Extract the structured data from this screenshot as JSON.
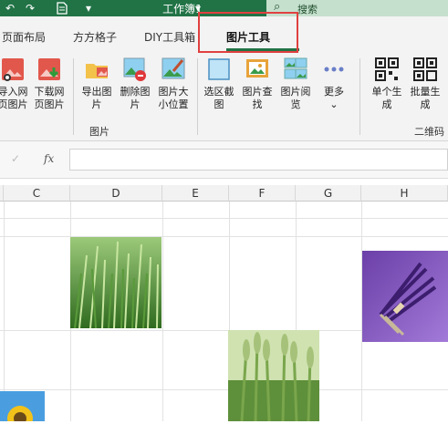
{
  "titlebar": {
    "title": "工作簿1",
    "search_label": "搜索",
    "icons": [
      "undo-icon",
      "redo-icon",
      "file-save-icon",
      "customize-dropdown-icon",
      "search-icon"
    ]
  },
  "tabs": [
    {
      "label": "页面布局"
    },
    {
      "label": "方方格子"
    },
    {
      "label": "DIY工具箱"
    },
    {
      "label": "图片工具",
      "active": true
    }
  ],
  "ribbon": {
    "buttons": [
      {
        "label": "导入网页图片"
      },
      {
        "label": "下载网页图片"
      },
      {
        "label": "导出图片"
      },
      {
        "label": "删除图片"
      },
      {
        "label": "图片大小位置"
      },
      {
        "label": "选区截图"
      },
      {
        "label": "图片查找"
      },
      {
        "label": "图片阅览"
      },
      {
        "label": "更多"
      },
      {
        "label": "单个生成"
      },
      {
        "label": "批量生成"
      }
    ],
    "groups": [
      {
        "label": "图片"
      },
      {
        "label": "二维码"
      }
    ]
  },
  "formula_bar": {
    "fx": "fx",
    "value": ""
  },
  "sheet": {
    "columns": [
      "C",
      "D",
      "E",
      "F",
      "G",
      "H"
    ],
    "images": [
      "wheat-field-image",
      "lavender-bouquet-image",
      "wheat-ears-image",
      "sunflower-image"
    ]
  },
  "colors": {
    "accent": "#217346",
    "highlight": "#e04040"
  }
}
